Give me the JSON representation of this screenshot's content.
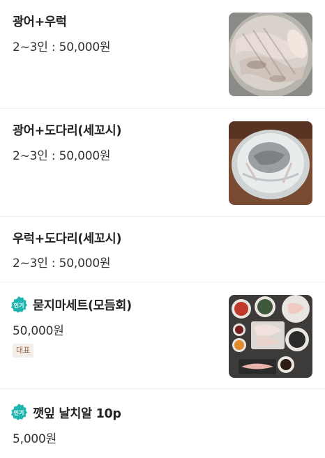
{
  "menu": {
    "items": [
      {
        "title": "광어+우럭",
        "price": "2~3인 : 50,000원",
        "has_image": true,
        "image": "flounder-rockfish-platter"
      },
      {
        "title": "광어+도다리(세꼬시)",
        "price": "2~3인 : 50,000원",
        "has_image": true,
        "image": "flounder-sekkoshi-platter"
      },
      {
        "title": "우럭+도다리(세꼬시)",
        "price": "2~3인 : 50,000원",
        "has_image": false
      },
      {
        "title": "묻지마세트(모듬회)",
        "price": "50,000원",
        "popular": true,
        "popular_label": "인기",
        "tag": "대표",
        "has_image": true,
        "image": "assorted-sashimi-set"
      },
      {
        "title": "깻잎 날치알 10p",
        "price": "5,000원",
        "popular": true,
        "popular_label": "인기",
        "has_image": false
      }
    ]
  },
  "colors": {
    "popular_badge": "#1fb5b0",
    "tag_bg": "#f3eeea",
    "tag_text": "#9a6d52",
    "divider": "#eeeeee"
  }
}
